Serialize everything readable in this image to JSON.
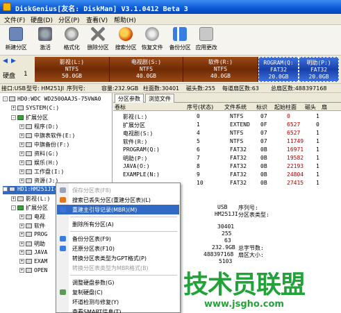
{
  "window": {
    "title": "DiskGenius[友名: DiskMan] V3.1.0412 Beta 3"
  },
  "menu": [
    "文件(F)",
    "硬盘(D)",
    "分区(P)",
    "查看(V)",
    "帮助(H)"
  ],
  "toolbar": [
    "新建分区",
    "激活",
    "格式化",
    "删除分区",
    "搜索分区",
    "恢复文件",
    "备份分区",
    "应用更改"
  ],
  "disk_bar": {
    "label": "硬盘",
    "num": "1",
    "partitions": [
      {
        "name": "影视(L:)",
        "fs": "NTFS",
        "size": "50.0GB"
      },
      {
        "name": "电视剧(S:)",
        "fs": "NTFS",
        "size": "40.0GB"
      },
      {
        "name": "软件(R:)",
        "fs": "NTFS",
        "size": "40.0GB"
      },
      {
        "name": "ROGRAM(Q:",
        "fs": "FAT32",
        "size": "20.0GB"
      },
      {
        "name": "明助(P:)",
        "fs": "FAT32",
        "size": "20.0GB"
      }
    ]
  },
  "info_bar": {
    "interface": "接口:USB",
    "model": "型号: HM251JI",
    "serial": "序列号:",
    "capacity": "容量:232.9GB",
    "cylinders": "柱面数:30401",
    "heads": "磁头数:255",
    "sectors": "每道扇区数:63",
    "total_sectors": "总扇区数:488397168"
  },
  "tree": [
    {
      "text": "HD0:WDC WD2500AAJS-75VWA0",
      "level": 0,
      "exp": "-"
    },
    {
      "text": "SYSTEM(C:)",
      "level": 1,
      "exp": "+"
    },
    {
      "text": "扩展分区",
      "level": 1,
      "exp": "-"
    },
    {
      "text": "程序(D:)",
      "level": 2,
      "exp": "+"
    },
    {
      "text": "中旗表软件(E:)",
      "level": 2,
      "exp": "+"
    },
    {
      "text": "中旗备份(F:)",
      "level": 2,
      "exp": "+"
    },
    {
      "text": "资料(G:)",
      "level": 2,
      "exp": "+"
    },
    {
      "text": "娱乐(H:)",
      "level": 2,
      "exp": "+"
    },
    {
      "text": "工作盘(I:)",
      "level": 2,
      "exp": "+"
    },
    {
      "text": "资源(J:)",
      "level": 2,
      "exp": "+"
    },
    {
      "text": "HD1:HM251JI(233GB)",
      "level": 0,
      "exp": "-",
      "selected": true
    },
    {
      "text": "影视(L:)",
      "level": 1,
      "exp": "+"
    },
    {
      "text": "扩展分区",
      "level": 1,
      "exp": "-"
    },
    {
      "text": "电视",
      "level": 2,
      "exp": "+"
    },
    {
      "text": "软件",
      "level": 2,
      "exp": "+"
    },
    {
      "text": "PROG",
      "level": 2,
      "exp": "+"
    },
    {
      "text": "明助",
      "level": 2,
      "exp": "+"
    },
    {
      "text": "JAVA",
      "level": 2,
      "exp": "+"
    },
    {
      "text": "EXAM",
      "level": 2,
      "exp": "+"
    },
    {
      "text": "OPEN",
      "level": 2,
      "exp": "+"
    }
  ],
  "tabs": [
    "分区参数",
    "浏览文件"
  ],
  "grid_headers": [
    "卷标",
    "序号(状态)",
    "文件系统",
    "标识",
    "起始柱面",
    "磁头",
    "扇"
  ],
  "grid_rows": [
    {
      "name": "影视(L:)",
      "idx": "0",
      "fs": "NTFS",
      "id": "07",
      "cyl": "0",
      "head": "1"
    },
    {
      "name": "扩展分区",
      "idx": "1",
      "fs": "EXTEND",
      "id": "0F",
      "cyl": "6527",
      "head": "0"
    },
    {
      "name": "电视剧(S:)",
      "idx": "4",
      "fs": "NTFS",
      "id": "07",
      "cyl": "6527",
      "head": "1"
    },
    {
      "name": "软件(R:)",
      "idx": "5",
      "fs": "NTFS",
      "id": "07",
      "cyl": "11749",
      "head": "1"
    },
    {
      "name": "PROGRAM(Q:)",
      "idx": "6",
      "fs": "FAT32",
      "id": "0B",
      "cyl": "16971",
      "head": "1"
    },
    {
      "name": "明助(P:)",
      "idx": "7",
      "fs": "FAT32",
      "id": "0B",
      "cyl": "19582",
      "head": "1"
    },
    {
      "name": "JAVA(O:)",
      "idx": "8",
      "fs": "FAT32",
      "id": "0B",
      "cyl": "22193",
      "head": "1"
    },
    {
      "name": "EXAMPLE(N:)",
      "idx": "9",
      "fs": "FAT32",
      "id": "0B",
      "cyl": "24804",
      "head": "1"
    },
    {
      "name": "",
      "idx": "10",
      "fs": "FAT32",
      "id": "0B",
      "cyl": "27415",
      "head": "1"
    }
  ],
  "details": {
    "interface": "USB",
    "model": "HM251JI",
    "serial_label": "序列号:",
    "ptable_label": "分区表类型:",
    "cylinders": "30401",
    "heads": "255",
    "sectors": "63",
    "capacity": "232.9GB",
    "total_bytes_label": "总字节数:",
    "total_sectors": "488397168",
    "sector_size_label": "扇区大小:",
    "extra": "5103"
  },
  "context_menu": [
    {
      "label": "保存分区表(F8)",
      "disabled": true,
      "icon": "save-icon"
    },
    {
      "label": "搜索已丢失分区(重建分区表)(L)",
      "disabled": false,
      "icon": "search-icon"
    },
    {
      "label": "重建主引导记录(MBR)(M)",
      "disabled": false,
      "hover": true,
      "icon": "mbr-icon"
    },
    {
      "sep": true
    },
    {
      "label": "删除所有分区(A)",
      "disabled": false
    },
    {
      "sep": true
    },
    {
      "label": "备份分区表(F9)",
      "disabled": false,
      "icon": "backup-icon"
    },
    {
      "label": "还原分区表(F10)",
      "disabled": false,
      "icon": "restore-icon"
    },
    {
      "label": "转换分区表类型为GPT格式(P)",
      "disabled": false
    },
    {
      "label": "转换分区表类型为MBR格式(B)",
      "disabled": true
    },
    {
      "sep": true
    },
    {
      "label": "调整硬盘参数(G)",
      "disabled": false
    },
    {
      "label": "复制硬盘(C)",
      "disabled": false,
      "icon": "copy-icon"
    },
    {
      "label": "坏道检测与修复(Y)",
      "disabled": false
    },
    {
      "label": "查看SMART信息(T)",
      "disabled": false
    }
  ],
  "watermark": {
    "text": "技术员联盟",
    "url": "www.jsgho.com"
  },
  "colors": {
    "title_bar": "#0a58d6",
    "partition_brown": "#7a2f08",
    "partition_blue": "#1f4fc0",
    "selection": "#316ac5",
    "watermark": "#23a23a"
  }
}
